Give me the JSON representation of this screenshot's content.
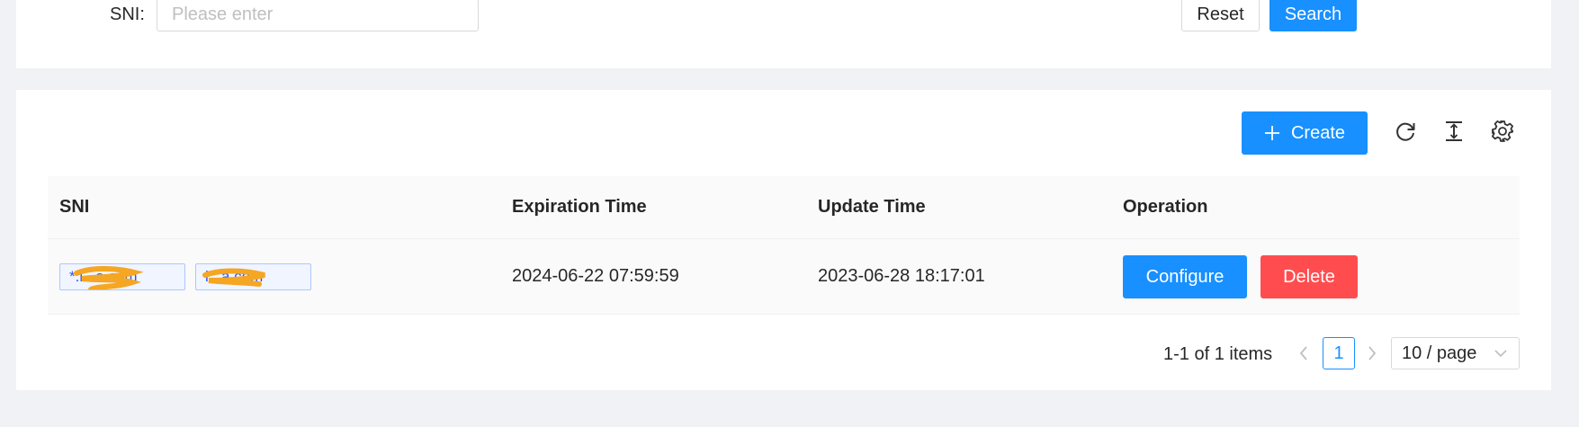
{
  "search_form": {
    "sni_label": "SNI:",
    "sni_placeholder": "Please enter",
    "reset_label": "Reset",
    "search_label": "Search"
  },
  "toolbar": {
    "create_label": "Create",
    "icons": [
      "reload-icon",
      "column-height-icon",
      "setting-icon"
    ]
  },
  "table": {
    "columns": [
      "SNI",
      "Expiration Time",
      "Update Time",
      "Operation"
    ],
    "rows": [
      {
        "sni_tags": [
          "*.l...a.com",
          "l...a.com"
        ],
        "expiration_time": "2024-06-22 07:59:59",
        "update_time": "2023-06-28 18:17:01",
        "configure_label": "Configure",
        "delete_label": "Delete"
      }
    ]
  },
  "pagination": {
    "summary": "1-1 of 1 items",
    "current_page": "1",
    "page_size": "10 / page"
  },
  "colors": {
    "primary": "#1890ff",
    "danger": "#ff4d4f",
    "background": "#f0f2f5",
    "redaction": "#f5a623"
  }
}
